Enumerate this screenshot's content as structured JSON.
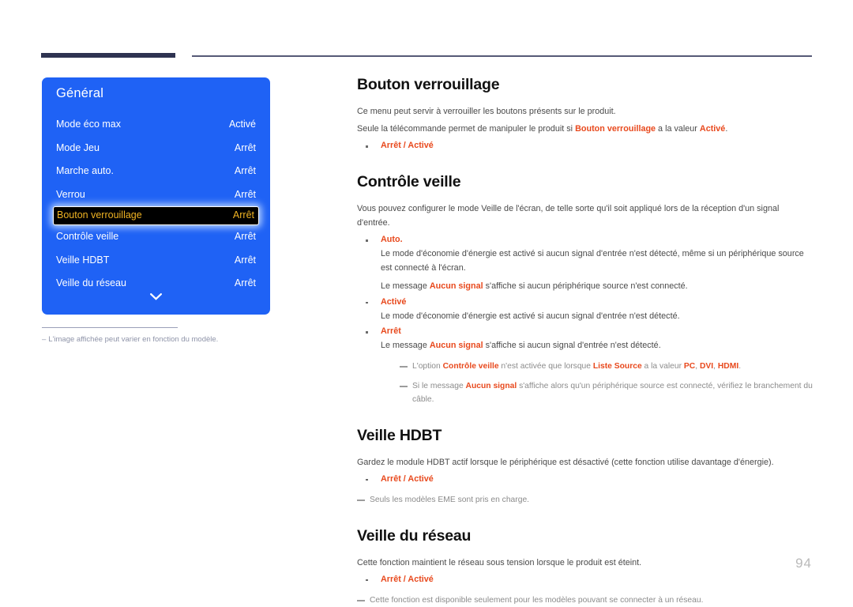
{
  "page": {
    "number": "94"
  },
  "osd": {
    "title": "Général",
    "rows": [
      {
        "label": "Mode éco max",
        "value": "Activé",
        "selected": false
      },
      {
        "label": "Mode Jeu",
        "value": "Arrêt",
        "selected": false
      },
      {
        "label": "Marche auto.",
        "value": "Arrêt",
        "selected": false
      },
      {
        "label": "Verrou",
        "value": "Arrêt",
        "selected": false
      },
      {
        "label": "Bouton verrouillage",
        "value": "Arrêt",
        "selected": true
      },
      {
        "label": "Contrôle veille",
        "value": "Arrêt",
        "selected": false
      },
      {
        "label": "Veille HDBT",
        "value": "Arrêt",
        "selected": false
      },
      {
        "label": "Veille du réseau",
        "value": "Arrêt",
        "selected": false
      }
    ],
    "more_icon": "chevron-down-icon",
    "footnote": {
      "dash": "–",
      "text": "L'image affichée peut varier en fonction du modèle."
    }
  },
  "sections": {
    "bouton_verrouillage": {
      "title": "Bouton verrouillage",
      "p1": "Ce menu peut servir à verrouiller les boutons présents sur le produit.",
      "p2_a": "Seule la télécommande permet de manipuler le produit si ",
      "p2_hl1": "Bouton verrouillage",
      "p2_b": " a la valeur ",
      "p2_hl2": "Activé",
      "p2_c": ".",
      "option": "Arrêt / Activé"
    },
    "controle_veille": {
      "title": "Contrôle veille",
      "p1": "Vous pouvez configurer le mode Veille de l'écran, de telle sorte qu'il soit appliqué lors de la réception d'un signal d'entrée.",
      "opt_auto_head": "Auto.",
      "opt_auto_b1": "Le mode d'économie d'énergie est activé si aucun signal d'entrée n'est détecté, même si un périphérique source est connecté à l'écran.",
      "opt_auto_b2_a": "Le message ",
      "opt_auto_b2_hl": "Aucun signal",
      "opt_auto_b2_b": " s'affiche si aucun périphérique source n'est connecté.",
      "opt_active_head": "Activé",
      "opt_active_b1": "Le mode d'économie d'énergie est activé si aucun signal d'entrée n'est détecté.",
      "opt_arret_head": "Arrêt",
      "opt_arret_b1_a": "Le message ",
      "opt_arret_b1_hl": "Aucun signal",
      "opt_arret_b1_b": " s'affiche si aucun signal d'entrée n'est détecté.",
      "note1_a": "L'option ",
      "note1_hl1": "Contrôle veille",
      "note1_b": " n'est activée que lorsque ",
      "note1_hl2": "Liste Source",
      "note1_c": " a la valeur ",
      "note1_hl3": "PC",
      "note1_d": ", ",
      "note1_hl4": "DVI",
      "note1_e": ", ",
      "note1_hl5": "HDMI",
      "note1_f": ".",
      "note2_a": "Si le message ",
      "note2_hl": "Aucun signal",
      "note2_b": " s'affiche alors qu'un périphérique source est connecté, vérifiez le branchement du câble."
    },
    "veille_hdbt": {
      "title": "Veille HDBT",
      "p1": "Gardez le module HDBT actif lorsque le périphérique est désactivé (cette fonction utilise davantage d'énergie).",
      "option": "Arrêt / Activé",
      "note": "Seuls les modèles EME sont pris en charge."
    },
    "veille_reseau": {
      "title": "Veille du réseau",
      "p1": "Cette fonction maintient le réseau sous tension lorsque le produit est éteint.",
      "option": "Arrêt / Activé",
      "note": "Cette fonction est disponible seulement pour les modèles pouvant se connecter à un réseau."
    }
  },
  "colors": {
    "osd_blue": "#1f62f5",
    "osd_selected_bg": "#000000",
    "osd_selected_text": "#f0b323",
    "accent_red": "#e8491d",
    "rule_dark": "#2e3351",
    "rule_thin": "#565a77"
  }
}
